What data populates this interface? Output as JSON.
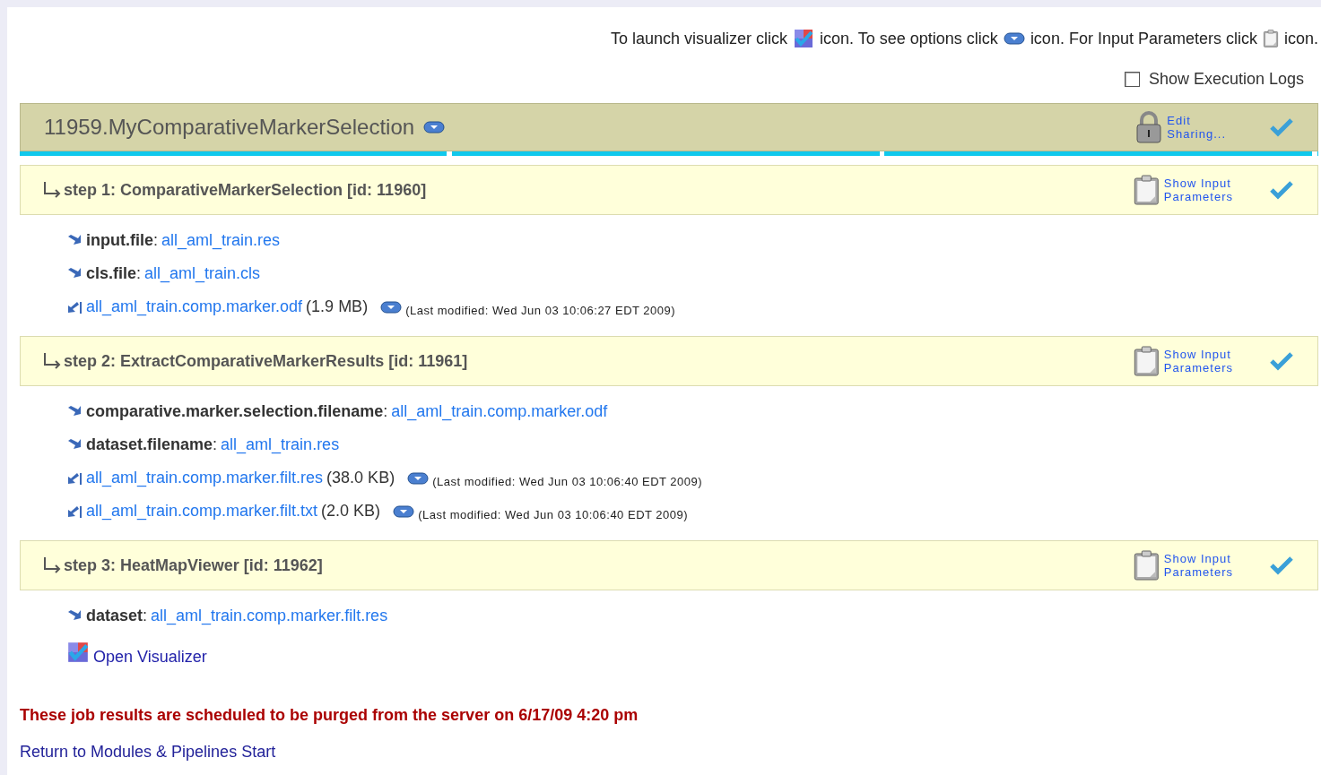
{
  "instructions": [
    "To launch visualizer click",
    "icon. To see options click",
    "icon. For Input Parameters click",
    "icon."
  ],
  "show_execution_logs": {
    "label": "Show Execution Logs",
    "checked": false
  },
  "job": {
    "title": "11959.MyComparativeMarkerSelection",
    "edit_sharing": "Edit\nSharing...",
    "progress": {
      "level": 1
    },
    "complete": true
  },
  "steps": [
    {
      "title": "step 1: ComparativeMarkerSelection [id: 11960]",
      "params_link": "Show Input\nParameters",
      "complete": true,
      "items": [
        {
          "kind": "input",
          "name": "**input.file**:",
          "value": "all_aml_train.res"
        },
        {
          "kind": "input",
          "name": "**cls.file**:",
          "value": "all_aml_train.cls"
        },
        {
          "kind": "output",
          "value": "all_aml_train.comp.marker.odf",
          "size": "(1.9 MB)",
          "modified": "(Last modified: Wed Jun 03 10:06:27 EDT 2009)"
        }
      ]
    },
    {
      "title": "step 2: ExtractComparativeMarkerResults [id: 11961]",
      "params_link": "Show Input\nParameters",
      "complete": true,
      "items": [
        {
          "kind": "input",
          "name": "**comparative.marker.selection.filename**:",
          "value": "all_aml_train.comp.marker.odf"
        },
        {
          "kind": "input",
          "name": "**dataset.filename**:",
          "value": "all_aml_train.res"
        },
        {
          "kind": "output",
          "value": "all_aml_train.comp.marker.filt.res",
          "size": "(38.0 KB)",
          "modified": "(Last modified: Wed Jun 03 10:06:40 EDT 2009)"
        },
        {
          "kind": "output",
          "value": "all_aml_train.comp.marker.filt.txt",
          "size": "(2.0 KB)",
          "modified": "(Last modified: Wed Jun 03 10:06:40 EDT 2009)"
        }
      ]
    },
    {
      "title": "step 3: HeatMapViewer [id: 11962]",
      "params_link": "Show Input\nParameters",
      "complete": true,
      "items": [
        {
          "kind": "input",
          "name": "**dataset**:",
          "value": "all_aml_train.comp.marker.filt.res"
        },
        {
          "kind": "visualizer",
          "value": "Open Visualizer"
        }
      ]
    }
  ],
  "purge_notice": "These job results are scheduled to be purged from the server on 6/17/09 4:20 pm",
  "return_link": "Return to Modules & Pipelines Start"
}
